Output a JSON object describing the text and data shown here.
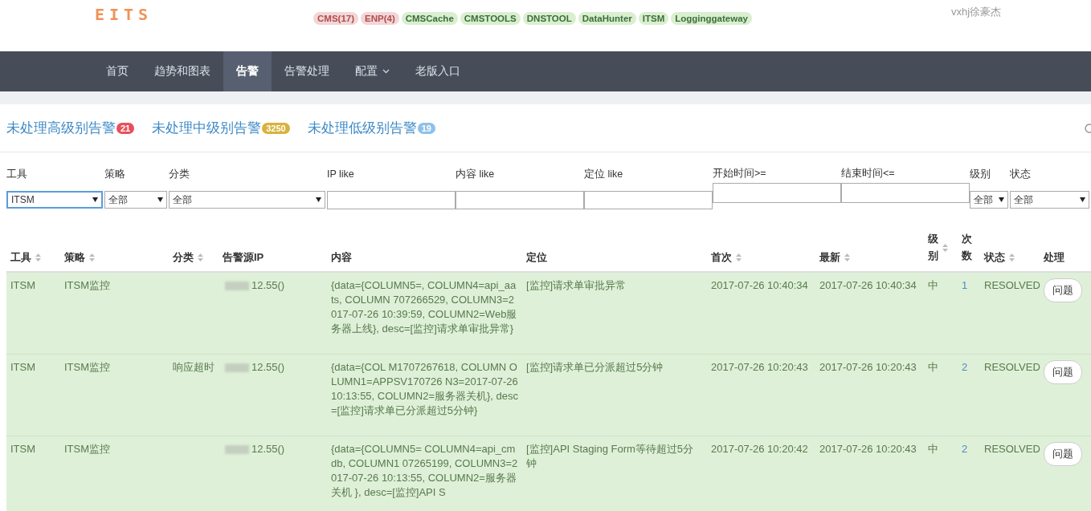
{
  "header": {
    "logo": "EITS",
    "tags": [
      {
        "label": "CMS(17)",
        "kind": "alert"
      },
      {
        "label": "ENP(4)",
        "kind": "alert"
      },
      {
        "label": "CMSCache",
        "kind": "ok"
      },
      {
        "label": "CMSTOOLS",
        "kind": "ok"
      },
      {
        "label": "DNSTOOL",
        "kind": "ok"
      },
      {
        "label": "DataHunter",
        "kind": "ok"
      },
      {
        "label": "ITSM",
        "kind": "ok"
      },
      {
        "label": "Logginggateway",
        "kind": "ok"
      }
    ],
    "user": "vxhj徐豪杰"
  },
  "nav": [
    {
      "label": "首页",
      "selected": false
    },
    {
      "label": "趋势和图表",
      "selected": false
    },
    {
      "label": "告警",
      "selected": true
    },
    {
      "label": "告警处理",
      "selected": false
    },
    {
      "label": "配置",
      "selected": false,
      "has_menu": true
    },
    {
      "label": "老版入口",
      "selected": false
    }
  ],
  "summary": [
    {
      "label": "未处理高级别告警",
      "count": "21",
      "color": "#e8505b"
    },
    {
      "label": "未处理中级别告警",
      "count": "3250",
      "color": "#d9b23c"
    },
    {
      "label": "未处理低级别告警",
      "count": "19",
      "color": "#8ec1ea"
    }
  ],
  "filters": [
    {
      "label": "工具",
      "kind": "select",
      "value": "ITSM",
      "focused": true
    },
    {
      "label": "策略",
      "kind": "select",
      "value": "全部",
      "focused": false
    },
    {
      "label": "分类",
      "kind": "select",
      "value": "全部",
      "focused": false
    },
    {
      "label": "IP like",
      "kind": "text"
    },
    {
      "label": "内容 like",
      "kind": "text"
    },
    {
      "label": "定位 like",
      "kind": "text"
    },
    {
      "label": "开始时间>=",
      "kind": "date"
    },
    {
      "label": "结束时间<=",
      "kind": "date"
    },
    {
      "label": "级别",
      "kind": "select",
      "value": "全部",
      "focused": false
    },
    {
      "label": "状态",
      "kind": "select",
      "value": "全部",
      "focused": false
    }
  ],
  "table": {
    "columns": [
      {
        "label": "工具",
        "kind": "sortable"
      },
      {
        "label": "策略",
        "kind": "sortable"
      },
      {
        "label": "分类",
        "kind": "sortable"
      },
      {
        "label": "告警源IP",
        "kind": "plain"
      },
      {
        "label": "内容",
        "kind": "plain"
      },
      {
        "label": "定位",
        "kind": "plain"
      },
      {
        "label": "首次",
        "kind": "sortable"
      },
      {
        "label": "最新",
        "kind": "sortable"
      },
      {
        "label": "级别",
        "kind": "sortable"
      },
      {
        "label": "次数",
        "kind": "plain"
      },
      {
        "label": "状态",
        "kind": "sortable"
      },
      {
        "label": "处理",
        "kind": "plain"
      }
    ],
    "rows": [
      {
        "tool": "ITSM",
        "strategy": "ITSM监控",
        "category": "",
        "ip": "12.55()",
        "content": "{data={COLUMN5=, COLUMN4=api_aats, COLUMN 707266529, COLUMN3=2017-07-26 10:39:59, COLUMN2=Web服务器上线}, desc=[监控]请求单审批异常}",
        "location": "[监控]请求单审批异常",
        "first": "2017-07-26 10:40:34",
        "latest": "2017-07-26 10:40:34",
        "level": "中",
        "count": "1",
        "status": "RESOLVED",
        "action": "问题"
      },
      {
        "tool": "ITSM",
        "strategy": "ITSM监控",
        "category": "响应超时",
        "ip": "12.55()",
        "content": "{data={COL M1707267618, COLUMN OLUMN1=APPSV170726 N3=2017-07-26 10:13:55, COLUMN2=服务器关机}, desc=[监控]请求单已分派超过5分钟}",
        "location": "[监控]请求单已分派超过5分钟",
        "first": "2017-07-26 10:20:43",
        "latest": "2017-07-26 10:20:43",
        "level": "中",
        "count": "2",
        "status": "RESOLVED",
        "action": "问题"
      },
      {
        "tool": "ITSM",
        "strategy": "ITSM监控",
        "category": "",
        "ip": "12.55()",
        "content": "{data={COLUMN5= COLUMN4=api_cmdb, COLUMN1 07265199, COLUMN3=2017-07-26 10:13:55, COLUMN2=服务器关机 }, desc=[监控]API S",
        "location": "[监控]API Staging Form等待超过5分钟",
        "first": "2017-07-26 10:20:42",
        "latest": "2017-07-26 10:20:43",
        "level": "中",
        "count": "2",
        "status": "RESOLVED",
        "action": "问题"
      }
    ]
  }
}
